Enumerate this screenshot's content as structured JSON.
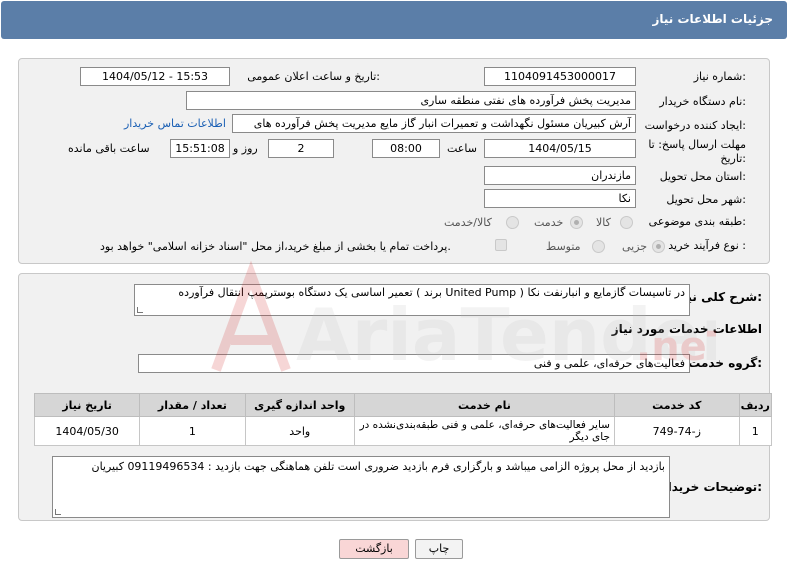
{
  "header": {
    "title": "جزئیات اطلاعات نیاز"
  },
  "fields": {
    "need_number": {
      "label": "شماره نیاز:",
      "value": "1104091453000017"
    },
    "announce_datetime": {
      "label": "تاریخ و ساعت اعلان عمومی:",
      "value": "1404/05/12 - 15:53"
    },
    "buyer_org": {
      "label": "نام دستگاه خریدار:",
      "value": "مدیریت پخش فرآورده های نفتی منطقه ساری"
    },
    "requester": {
      "label": "ایجاد کننده درخواست:",
      "value": "آرش کبیریان مسئول نگهداشت و تعمیرات انبار گاز مایع مدیریت پخش فرآورده های",
      "contact_link": "اطلاعات تماس خریدار"
    },
    "deadline": {
      "label_line1": "مهلت ارسال پاسخ: تا",
      "label_line2": "تاریخ:",
      "date": "1404/05/15",
      "time_label": "ساعت",
      "time": "08:00",
      "days": "2",
      "days_label": "روز و",
      "remaining_time": "15:51:08",
      "remaining_label": "ساعت باقی مانده"
    },
    "province": {
      "label": "استان محل تحویل:",
      "value": "مازندران"
    },
    "city": {
      "label": "شهر محل تحویل:",
      "value": "نکا"
    },
    "category": {
      "label": "طبقه بندی موضوعی:",
      "options": [
        "کالا",
        "خدمت",
        "کالا/خدمت"
      ],
      "selected": "خدمت"
    },
    "purchase_type": {
      "label": "نوع فرآیند خرید :",
      "options": [
        "جزیی",
        "متوسط"
      ],
      "selected": "جزیی",
      "payment_note": "پرداخت تمام یا بخشی از مبلغ خرید،از محل \"اسناد خزانه اسلامی\" خواهد بود."
    }
  },
  "summary": {
    "label": "شرح کلی نیاز:",
    "value": "تعمیر اساسی یک دستگاه بوسترپمپ انتقال فرآورده ( برند United Pump ) در تاسیسات گازمایع و انبارنفت نکا"
  },
  "services": {
    "section_title": "اطلاعات خدمات مورد نیاز",
    "group_label": "گروه خدمت:",
    "group_value": "فعالیت‌های حرفه‌ای، علمی و فنی",
    "columns": [
      "ردیف",
      "کد خدمت",
      "نام خدمت",
      "واحد اندازه گیری",
      "تعداد / مقدار",
      "تاریخ نیاز"
    ],
    "rows": [
      {
        "row": "1",
        "code": "ز-74-749",
        "name": "سایر فعالیت‌های حرفه‌ای، علمی و فنی طبقه‌بندی‌نشده در جای دیگر",
        "unit": "واحد",
        "qty": "1",
        "date": "1404/05/30"
      }
    ]
  },
  "buyer_notes": {
    "label": "توضیحات خریدار:",
    "value": "بازدید از محل پروژه الزامی میباشد و بارگزاری فرم بازدید ضروری است تلفن هماهنگی جهت بازدید : 09119496534 کبیریان"
  },
  "buttons": {
    "print": "چاپ",
    "back": "بازگشت"
  },
  "watermark": {
    "text": "AriaTender.neT"
  }
}
